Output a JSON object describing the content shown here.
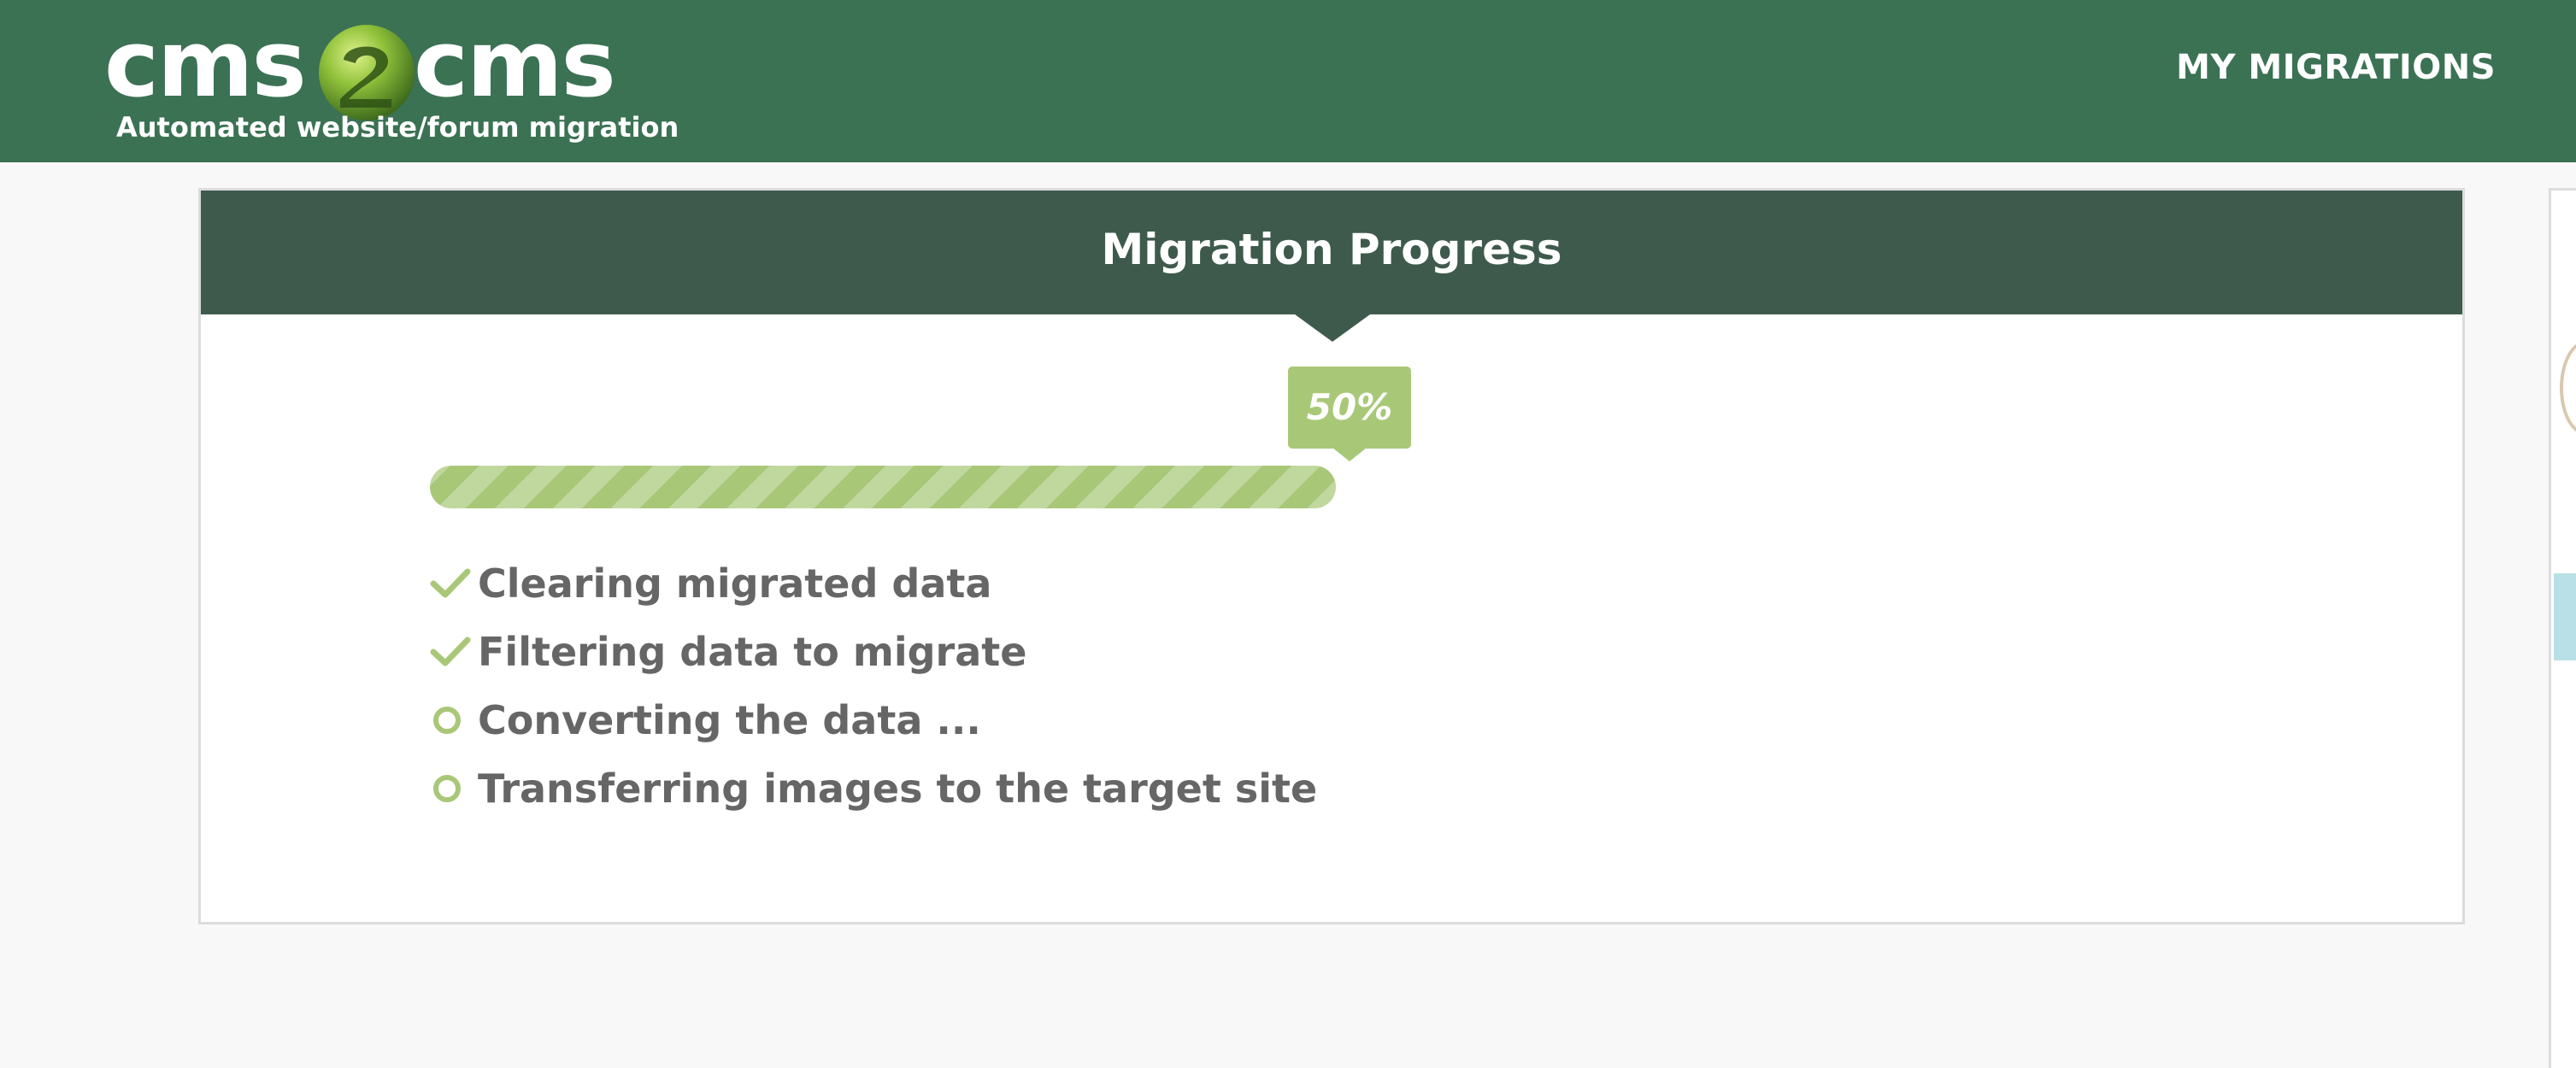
{
  "header": {
    "logo_left": "cms",
    "logo_right": "cms",
    "logo_tagline": "Automated website/forum migration",
    "nav_my_migrations": "MY MIGRATIONS",
    "bg_color": "#3b7254"
  },
  "progress_card": {
    "title": "Migration Progress",
    "percent_label": "50%",
    "percent_value": 0.5,
    "accent_color": "#a8c878",
    "steps": [
      {
        "label": "Clearing migrated data",
        "status": "done",
        "icon": "checkmark-icon"
      },
      {
        "label": "Filtering data to migrate",
        "status": "done",
        "icon": "checkmark-icon"
      },
      {
        "label": "Converting the data ...",
        "status": "in-progress",
        "icon": "pending-circle-icon"
      },
      {
        "label": "Transferring images to the target site",
        "status": "pending",
        "icon": "pending-circle-icon"
      }
    ]
  }
}
